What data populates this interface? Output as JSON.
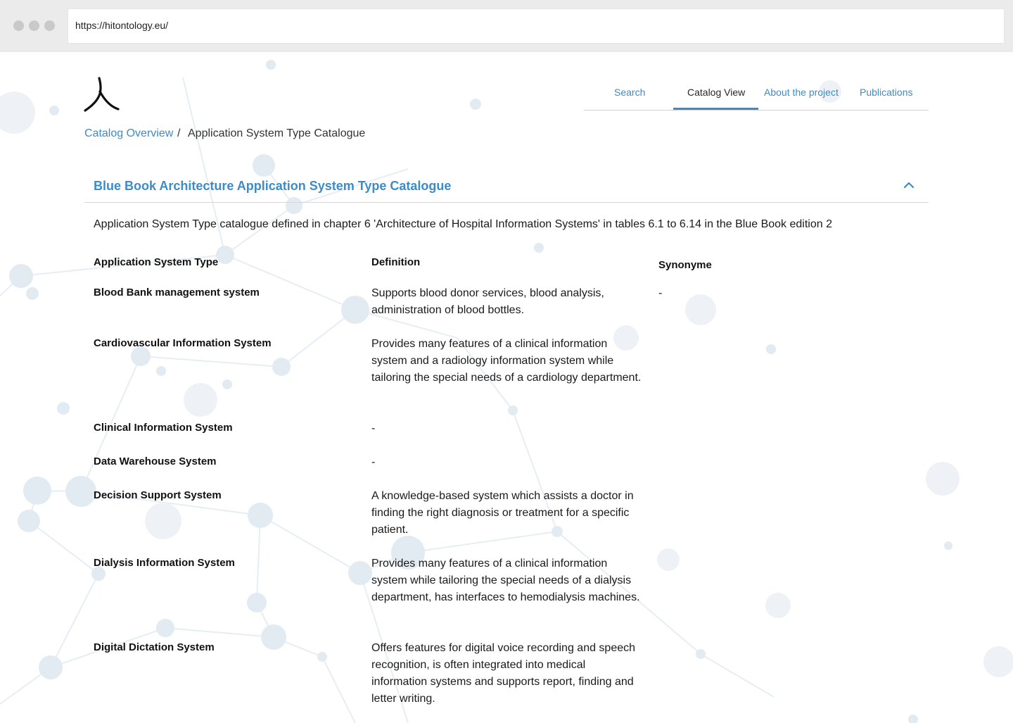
{
  "browser": {
    "url": "https://hitontology.eu/"
  },
  "logo": {
    "glyph": "人"
  },
  "nav": {
    "items": [
      {
        "label": "Search",
        "active": false
      },
      {
        "label": "Catalog View",
        "active": true
      },
      {
        "label": "About the project",
        "active": false
      },
      {
        "label": "Publications",
        "active": false
      }
    ]
  },
  "breadcrumb": {
    "parent": "Catalog Overview",
    "separator": "/",
    "current": "Application System Type Catalogue"
  },
  "panel": {
    "title": "Blue Book Architecture Application System Type Catalogue",
    "description": "Application System Type catalogue defined in chapter 6 'Architecture of Hospital Information Systems' in tables 6.1 to 6.14 in the Blue Book edition 2"
  },
  "table": {
    "headers": [
      "Application System Type",
      "Definition",
      "Synonyme"
    ],
    "rows": [
      {
        "name": "Blood Bank management system",
        "definition": "Supports blood donor services, blood analysis, administration of blood bottles.",
        "synonym": "-"
      },
      {
        "name": "Cardiovascular Information System",
        "definition": "Provides many features of a clinical information system and a radiology information system while tailoring the special needs of a cardiology department.",
        "synonym": ""
      },
      {
        "name": "Clinical Information System",
        "definition": "-",
        "synonym": ""
      },
      {
        "name": "Data Warehouse System",
        "definition": "-",
        "synonym": ""
      },
      {
        "name": "Decision Support System",
        "definition": "A knowledge-based system which assists a doctor in finding the right diagnosis or treatment for a specific patient.",
        "synonym": ""
      },
      {
        "name": "Dialysis Information System",
        "definition": "Provides many features of a clinical information system while tailoring the special needs of a dialysis department, has interfaces to hemodialysis machines.",
        "synonym": ""
      },
      {
        "name": "Digital Dictation System",
        "definition": "Offers features for digital voice recording and speech recognition, is often integrated into medical information systems and supports report, finding and letter writing.",
        "synonym": ""
      }
    ]
  },
  "colors": {
    "accent": "#3d8bc7",
    "text": "#1a1a1a",
    "network": "#d6e2ee"
  }
}
